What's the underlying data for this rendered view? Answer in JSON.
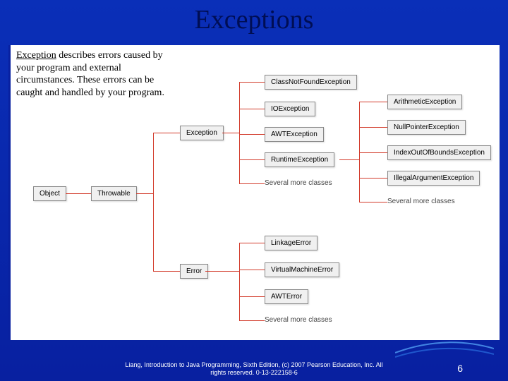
{
  "title": "Exceptions",
  "description_lead": "Exception",
  "description_rest": " describes errors caused by your program and external circumstances. These errors can be caught and handled by your program.",
  "nodes": {
    "object": "Object",
    "throwable": "Throwable",
    "exception": "Exception",
    "error": "Error",
    "class_not_found": "ClassNotFoundException",
    "ioexception": "IOException",
    "awtexception": "AWTException",
    "runtime_exception": "RuntimeException",
    "more1": "Several more classes",
    "arithmetic": "ArithmeticException",
    "nullpointer": "NullPointerException",
    "indexoob": "IndexOutOfBoundsException",
    "illegalarg": "IllegalArgumentException",
    "more2": "Several more classes",
    "linkage": "LinkageError",
    "vm_error": "VirtualMachineError",
    "awterror": "AWTError",
    "more3": "Several more classes"
  },
  "footer_line1": "Liang, Introduction to Java Programming, Sixth Edition, (c) 2007 Pearson Education, Inc. All",
  "footer_line2": "rights reserved. 0-13-222158-6",
  "page_number": "6"
}
